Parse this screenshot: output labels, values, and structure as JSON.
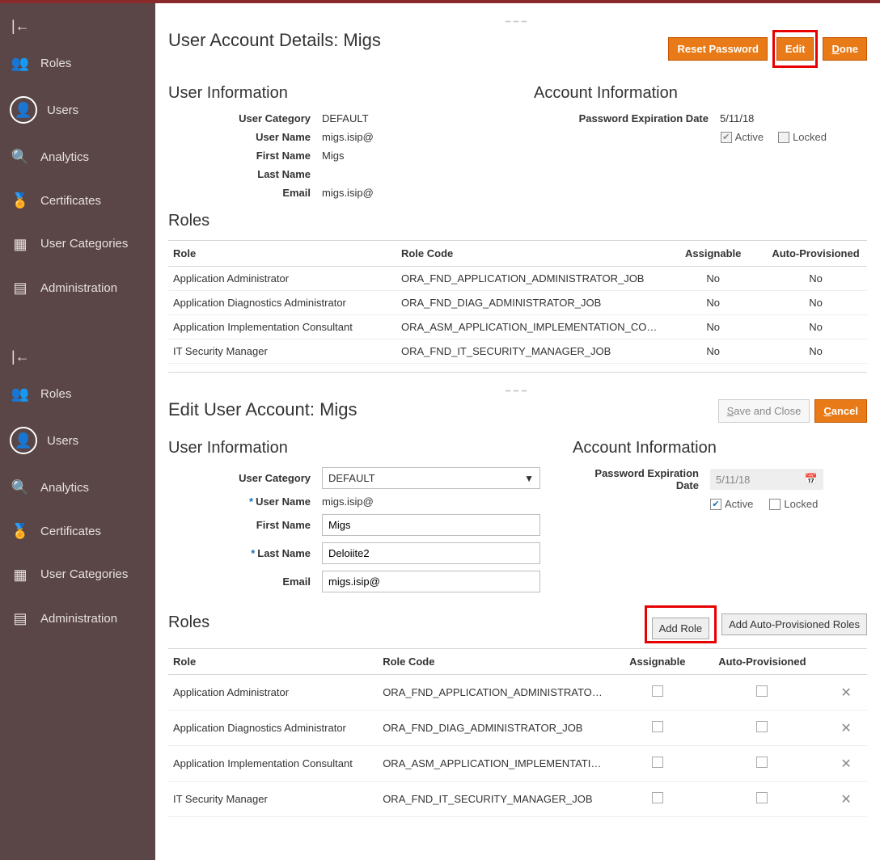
{
  "sidebar": {
    "items": [
      {
        "label": "Roles"
      },
      {
        "label": "Users"
      },
      {
        "label": "Analytics"
      },
      {
        "label": "Certificates"
      },
      {
        "label": "User Categories"
      },
      {
        "label": "Administration"
      }
    ]
  },
  "details": {
    "title": "User Account Details: Migs",
    "buttons": {
      "reset": "Reset Password",
      "edit": "Edit",
      "done_prefix": "D",
      "done_rest": "one"
    },
    "userInfoHeading": "User Information",
    "accountInfoHeading": "Account Information",
    "labels": {
      "userCategory": "User Category",
      "userName": "User Name",
      "firstName": "First Name",
      "lastName": "Last Name",
      "email": "Email",
      "pwdExp": "Password Expiration Date",
      "active": "Active",
      "locked": "Locked"
    },
    "values": {
      "userCategory": "DEFAULT",
      "userName": "migs.isip@",
      "firstName": "Migs",
      "lastName": "",
      "email": "migs.isip@",
      "pwdExp": "5/11/18"
    },
    "rolesHeading": "Roles",
    "roleColumns": {
      "role": "Role",
      "code": "Role Code",
      "assignable": "Assignable",
      "auto": "Auto-Provisioned"
    },
    "roles": [
      {
        "role": "Application Administrator",
        "code": "ORA_FND_APPLICATION_ADMINISTRATOR_JOB",
        "assignable": "No",
        "auto": "No"
      },
      {
        "role": "Application Diagnostics Administrator",
        "code": "ORA_FND_DIAG_ADMINISTRATOR_JOB",
        "assignable": "No",
        "auto": "No"
      },
      {
        "role": "Application Implementation Consultant",
        "code": "ORA_ASM_APPLICATION_IMPLEMENTATION_CO…",
        "assignable": "No",
        "auto": "No"
      },
      {
        "role": "IT Security Manager",
        "code": "ORA_FND_IT_SECURITY_MANAGER_JOB",
        "assignable": "No",
        "auto": "No"
      }
    ]
  },
  "edit": {
    "title": "Edit User Account: Migs",
    "buttons": {
      "save_prefix": "S",
      "save_rest": "ave and Close",
      "cancel_prefix": "C",
      "cancel_rest": "ancel",
      "addRole": "Add Role",
      "addAuto": "Add Auto-Provisioned Roles"
    },
    "values": {
      "userCategory": "DEFAULT",
      "userName": "migs.isip@",
      "firstName": "Migs",
      "lastName": "Deloiite2",
      "email": "migs.isip@",
      "pwdExp": "5/11/18"
    },
    "roles": [
      {
        "role": "Application Administrator",
        "code": "ORA_FND_APPLICATION_ADMINISTRATO…"
      },
      {
        "role": "Application Diagnostics Administrator",
        "code": "ORA_FND_DIAG_ADMINISTRATOR_JOB"
      },
      {
        "role": "Application Implementation Consultant",
        "code": "ORA_ASM_APPLICATION_IMPLEMENTATI…"
      },
      {
        "role": "IT Security Manager",
        "code": "ORA_FND_IT_SECURITY_MANAGER_JOB"
      }
    ]
  }
}
